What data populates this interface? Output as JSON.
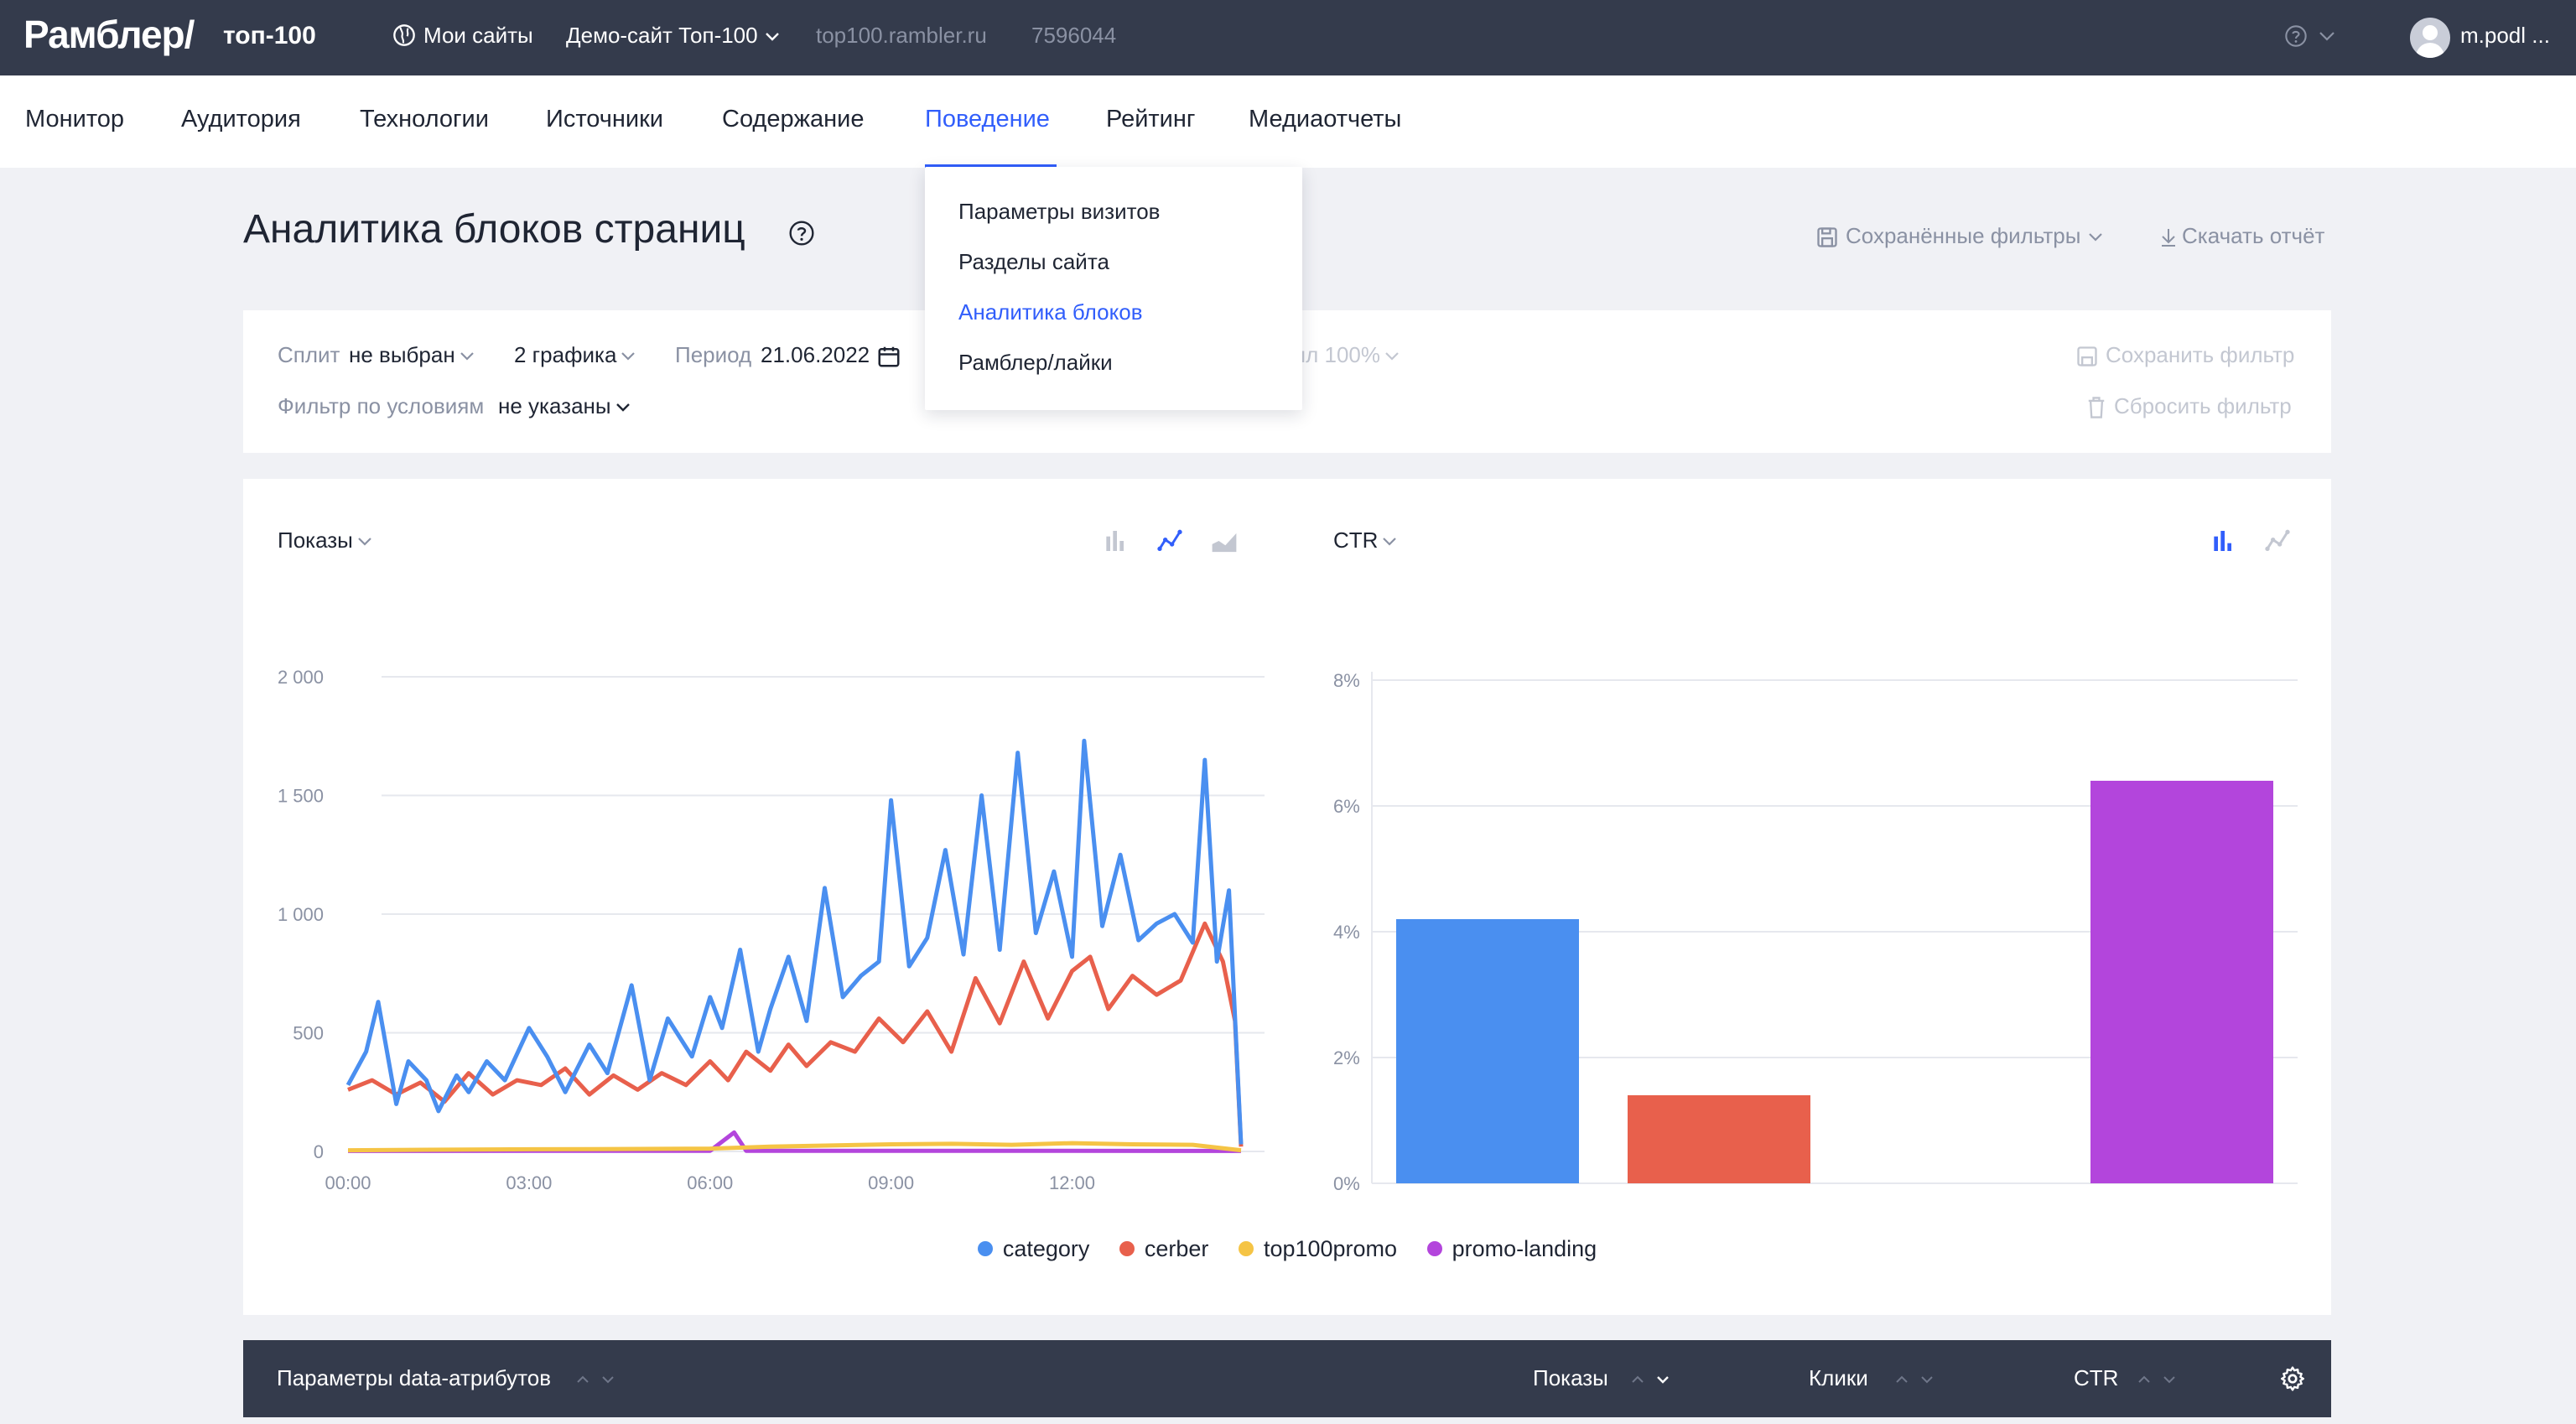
{
  "topbar": {
    "logo": "Рамблер/",
    "logo_sub": "топ-100",
    "my_sites": "Мои сайты",
    "site_select": "Демо-сайт Топ-100",
    "site_url": "top100.rambler.ru",
    "site_id": "7596044",
    "user": "m.podl ..."
  },
  "nav": {
    "items": [
      "Монитор",
      "Аудитория",
      "Технологии",
      "Источники",
      "Содержание",
      "Поведение",
      "Рейтинг",
      "Медиаотчеты"
    ],
    "active": "Поведение"
  },
  "dropdown": {
    "items": [
      "Параметры визитов",
      "Разделы сайта",
      "Аналитика блоков",
      "Рамблер/лайки"
    ],
    "active": "Аналитика блоков"
  },
  "page": {
    "title": "Аналитика блоков страниц",
    "saved_filters": "Сохранённые фильтры",
    "download": "Скачать отчёт"
  },
  "filters": {
    "split_label": "Сплит",
    "split_value": "не выбран",
    "graphs_value": "2 графика",
    "period_label": "Период",
    "period_value": "21.06.2022",
    "sample_label": "пл",
    "sample_value": "100%",
    "conditions_label": "Фильтр по условиям",
    "conditions_value": "не указаны",
    "save_filter": "Сохранить фильтр",
    "reset_filter": "Сбросить фильтр"
  },
  "colors": {
    "category": "#4a8ff0",
    "cerber": "#e8604c",
    "top100promo": "#f5c445",
    "promo_landing": "#b345dc",
    "accent": "#315efb",
    "dark": "#343b4c"
  },
  "left_chart": {
    "metric": "Показы",
    "icons": [
      "bar-chart-icon",
      "line-chart-icon",
      "area-chart-icon"
    ],
    "active_icon": "line-chart-icon"
  },
  "right_chart": {
    "metric": "CTR",
    "icons": [
      "bar-chart-icon",
      "line-chart-icon"
    ],
    "active_icon": "bar-chart-icon"
  },
  "chart_data": [
    {
      "type": "line",
      "title": "",
      "ylim": [
        0,
        2000
      ],
      "y_ticks": [
        "0",
        "500",
        "1 000",
        "1 500",
        "2 000"
      ],
      "x_ticks": [
        "00:00",
        "03:00",
        "06:00",
        "09:00",
        "12:00"
      ],
      "xlim_hours": [
        0,
        14.8
      ],
      "grid": true,
      "series": [
        {
          "name": "category",
          "color": "#4a8ff0",
          "points": [
            [
              0,
              280
            ],
            [
              0.3,
              420
            ],
            [
              0.5,
              630
            ],
            [
              0.8,
              200
            ],
            [
              1,
              380
            ],
            [
              1.3,
              300
            ],
            [
              1.5,
              170
            ],
            [
              1.8,
              320
            ],
            [
              2,
              250
            ],
            [
              2.3,
              380
            ],
            [
              2.6,
              300
            ],
            [
              3,
              520
            ],
            [
              3.3,
              400
            ],
            [
              3.6,
              250
            ],
            [
              4,
              450
            ],
            [
              4.3,
              330
            ],
            [
              4.7,
              700
            ],
            [
              5,
              300
            ],
            [
              5.3,
              560
            ],
            [
              5.7,
              400
            ],
            [
              6,
              650
            ],
            [
              6.2,
              520
            ],
            [
              6.5,
              850
            ],
            [
              6.8,
              420
            ],
            [
              7,
              600
            ],
            [
              7.3,
              820
            ],
            [
              7.6,
              550
            ],
            [
              7.9,
              1110
            ],
            [
              8.2,
              650
            ],
            [
              8.5,
              740
            ],
            [
              8.8,
              800
            ],
            [
              9,
              1480
            ],
            [
              9.3,
              780
            ],
            [
              9.6,
              900
            ],
            [
              9.9,
              1270
            ],
            [
              10.2,
              830
            ],
            [
              10.5,
              1500
            ],
            [
              10.8,
              850
            ],
            [
              11.1,
              1680
            ],
            [
              11.4,
              920
            ],
            [
              11.7,
              1180
            ],
            [
              12,
              820
            ],
            [
              12.2,
              1730
            ],
            [
              12.5,
              950
            ],
            [
              12.8,
              1250
            ],
            [
              13.1,
              890
            ],
            [
              13.4,
              960
            ],
            [
              13.7,
              1000
            ],
            [
              14,
              880
            ],
            [
              14.2,
              1650
            ],
            [
              14.4,
              800
            ],
            [
              14.6,
              1100
            ],
            [
              14.8,
              30
            ]
          ]
        },
        {
          "name": "cerber",
          "color": "#e8604c",
          "points": [
            [
              0,
              260
            ],
            [
              0.4,
              300
            ],
            [
              0.8,
              240
            ],
            [
              1.2,
              290
            ],
            [
              1.6,
              210
            ],
            [
              2,
              330
            ],
            [
              2.4,
              240
            ],
            [
              2.8,
              300
            ],
            [
              3.2,
              280
            ],
            [
              3.6,
              350
            ],
            [
              4,
              240
            ],
            [
              4.4,
              320
            ],
            [
              4.8,
              260
            ],
            [
              5.2,
              330
            ],
            [
              5.6,
              280
            ],
            [
              6,
              380
            ],
            [
              6.3,
              300
            ],
            [
              6.6,
              420
            ],
            [
              7,
              340
            ],
            [
              7.3,
              450
            ],
            [
              7.6,
              360
            ],
            [
              8,
              460
            ],
            [
              8.4,
              420
            ],
            [
              8.8,
              560
            ],
            [
              9.2,
              460
            ],
            [
              9.6,
              590
            ],
            [
              10,
              420
            ],
            [
              10.4,
              730
            ],
            [
              10.8,
              540
            ],
            [
              11.2,
              800
            ],
            [
              11.6,
              560
            ],
            [
              12,
              760
            ],
            [
              12.3,
              820
            ],
            [
              12.6,
              600
            ],
            [
              13,
              740
            ],
            [
              13.4,
              660
            ],
            [
              13.8,
              720
            ],
            [
              14.2,
              960
            ],
            [
              14.5,
              800
            ],
            [
              14.7,
              550
            ],
            [
              14.8,
              20
            ]
          ]
        },
        {
          "name": "top100promo",
          "color": "#f5c445",
          "points": [
            [
              0,
              5
            ],
            [
              2,
              8
            ],
            [
              4,
              10
            ],
            [
              6,
              12
            ],
            [
              7,
              20
            ],
            [
              8,
              25
            ],
            [
              9,
              30
            ],
            [
              10,
              32
            ],
            [
              11,
              28
            ],
            [
              12,
              35
            ],
            [
              13,
              30
            ],
            [
              14,
              28
            ],
            [
              14.8,
              5
            ]
          ]
        },
        {
          "name": "promo-landing",
          "color": "#b345dc",
          "points": [
            [
              0,
              2
            ],
            [
              6,
              3
            ],
            [
              6.4,
              80
            ],
            [
              6.6,
              3
            ],
            [
              10,
              3
            ],
            [
              14.8,
              2
            ]
          ]
        }
      ]
    },
    {
      "type": "bar",
      "title": "",
      "ylim": [
        0,
        8
      ],
      "y_ticks": [
        "0%",
        "2%",
        "4%",
        "6%",
        "8%"
      ],
      "categories": [
        "category",
        "cerber",
        "top100promo",
        "promo-landing"
      ],
      "values": [
        4.2,
        1.4,
        0,
        6.4
      ],
      "colors": [
        "#4a8ff0",
        "#e8604c",
        "#f5c445",
        "#b345dc"
      ],
      "grid": true
    }
  ],
  "legend": [
    "category",
    "cerber",
    "top100promo",
    "promo-landing"
  ],
  "table": {
    "col_params": "Параметры data-атрибутов",
    "col_shows": "Показы",
    "col_clicks": "Клики",
    "col_ctr": "CTR"
  }
}
